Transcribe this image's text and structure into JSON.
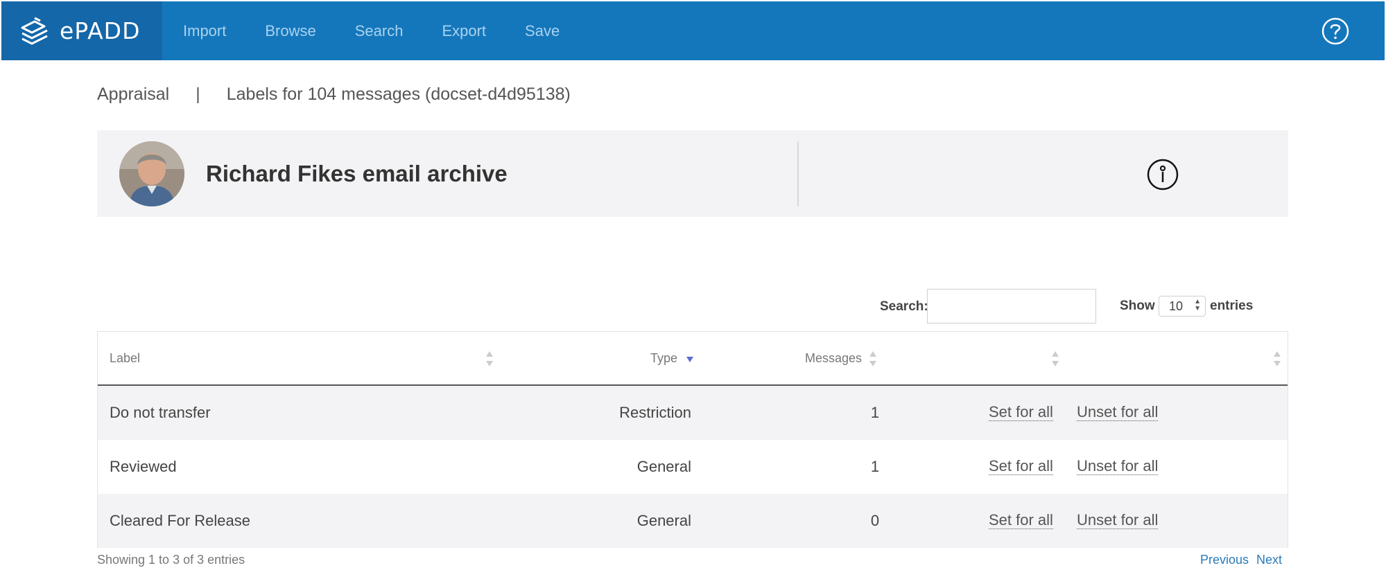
{
  "brand": {
    "name": "ePADD",
    "logo_icon": "epadd-logo-icon"
  },
  "nav": {
    "items": [
      "Import",
      "Browse",
      "Search",
      "Export",
      "Save"
    ],
    "help_icon": "help-circle-icon"
  },
  "breadcrumb": {
    "section": "Appraisal",
    "separator": "|",
    "title": "Labels for 104 messages (docset-d4d95138)"
  },
  "archive": {
    "title": "Richard Fikes email archive",
    "info_icon": "info-circle-icon"
  },
  "controls": {
    "search_label": "Search:",
    "search_value": "",
    "show_label": "Show",
    "entries_value": "10",
    "entries_label": "entries"
  },
  "table": {
    "columns": [
      "Label",
      "Type",
      "Messages",
      "",
      ""
    ],
    "sorted_column": "Type",
    "rows": [
      {
        "label": "Do not transfer",
        "type": "Restriction",
        "messages": "1",
        "set": "Set for all",
        "unset": "Unset for all"
      },
      {
        "label": "Reviewed",
        "type": "General",
        "messages": "1",
        "set": "Set for all",
        "unset": "Unset for all"
      },
      {
        "label": "Cleared For Release",
        "type": "General",
        "messages": "0",
        "set": "Set for all",
        "unset": "Unset for all"
      }
    ]
  },
  "footer": {
    "info": "Showing 1 to 3 of 3 entries",
    "previous": "Previous",
    "next": "Next"
  },
  "colors": {
    "nav_bg": "#1577bb",
    "brand_bg": "#1467a8",
    "nav_link": "#a9d2ef",
    "sort_active": "#5b6ccf",
    "pager_link": "#2a7ab9"
  }
}
